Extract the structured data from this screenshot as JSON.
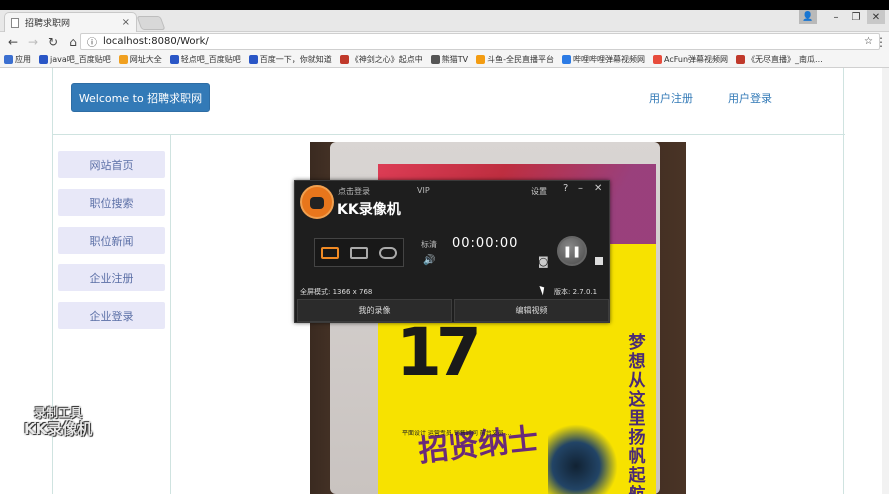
{
  "browser": {
    "tab_title": "招聘求职网",
    "tab_close": "×",
    "url": "localhost:8080/Work/",
    "win_user": "👤",
    "win_min": "–",
    "win_max": "❐",
    "win_close": "✕"
  },
  "bookmarks": [
    {
      "label": "应用",
      "color": "#3b6fd0"
    },
    {
      "label": "java吧_百度贴吧",
      "color": "#2a56c6"
    },
    {
      "label": "网址大全",
      "color": "#f0a020"
    },
    {
      "label": "轻点吧_百度贴吧",
      "color": "#2a56c6"
    },
    {
      "label": "百度一下，你就知道",
      "color": "#2a56c6"
    },
    {
      "label": "《神剑之心》起点中",
      "color": "#c0392b"
    },
    {
      "label": "熊猫TV",
      "color": "#555555"
    },
    {
      "label": "斗鱼-全民直播平台",
      "color": "#f39c12"
    },
    {
      "label": "哔哩哔哩弹幕视频网",
      "color": "#2c7be5"
    },
    {
      "label": "AcFun弹幕视频网",
      "color": "#e74c3c"
    },
    {
      "label": "《无尽直播》_南瓜...",
      "color": "#c0392b"
    }
  ],
  "site": {
    "brand": "Welcome to 招聘求职网",
    "register_link": "用户注册",
    "login_link": "用户登录",
    "sidebar": [
      "网站首页",
      "职位搜索",
      "职位新闻",
      "企业注册",
      "企业登录"
    ]
  },
  "poster": {
    "big_text": "17",
    "callig": "招贤纳士",
    "vertical": "梦想从这里扬帆起航",
    "small": "平面设计 运营专员 销售顾问 前台文员 ..."
  },
  "recorder": {
    "login": "点击登录",
    "vip": "VIP",
    "settings": "设置",
    "help": "?",
    "minimize": "–",
    "close": "✕",
    "app_name": "KK录像机",
    "quality": "标清",
    "volume_icon": "🔊",
    "timer": "00:00:00",
    "record_button": "❚❚",
    "mode": "全屏模式: 1366 x 768",
    "version": "版本: 2.7.0.1",
    "my_recordings": "我的录像",
    "edit_video": "编辑视频"
  },
  "watermark": {
    "line1": "录制工具",
    "line2": "KK录像机"
  }
}
